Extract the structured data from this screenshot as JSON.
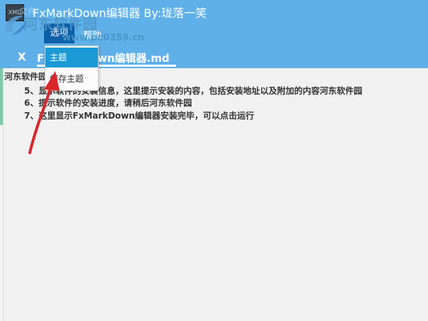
{
  "window": {
    "app_icon_text": "XMD",
    "title": "FxMarkDown编辑器  By:珑落一笑"
  },
  "menubar": {
    "items": [
      {
        "label": "文件"
      },
      {
        "label": "选项"
      },
      {
        "label": "帮助"
      }
    ]
  },
  "tab": {
    "close_label": "X",
    "title": "FxMarkDown编辑器.md"
  },
  "dropdown": {
    "items": [
      {
        "label": "主题",
        "selected": true
      },
      {
        "label": "保存主题",
        "selected": false
      }
    ]
  },
  "editor": {
    "lines": [
      "河东软件园",
      "5、显示软件的安装信息，这里提示安装的内容，包括安装地址以及附加的内容河东软件园",
      "6、提示软件的安装进度，请稍后河东软件园",
      "7、这里显示FxMarkDown编辑器安装完毕，可以点击运行"
    ]
  },
  "watermark": {
    "text": "河东软件园",
    "url": "www.pc0359.cn"
  },
  "colors": {
    "accent": "#5fb0e9",
    "menu_active": "#0d5fa8",
    "dropdown_selected": "#1c9ad6",
    "annotation_arrow": "#d9262b"
  }
}
